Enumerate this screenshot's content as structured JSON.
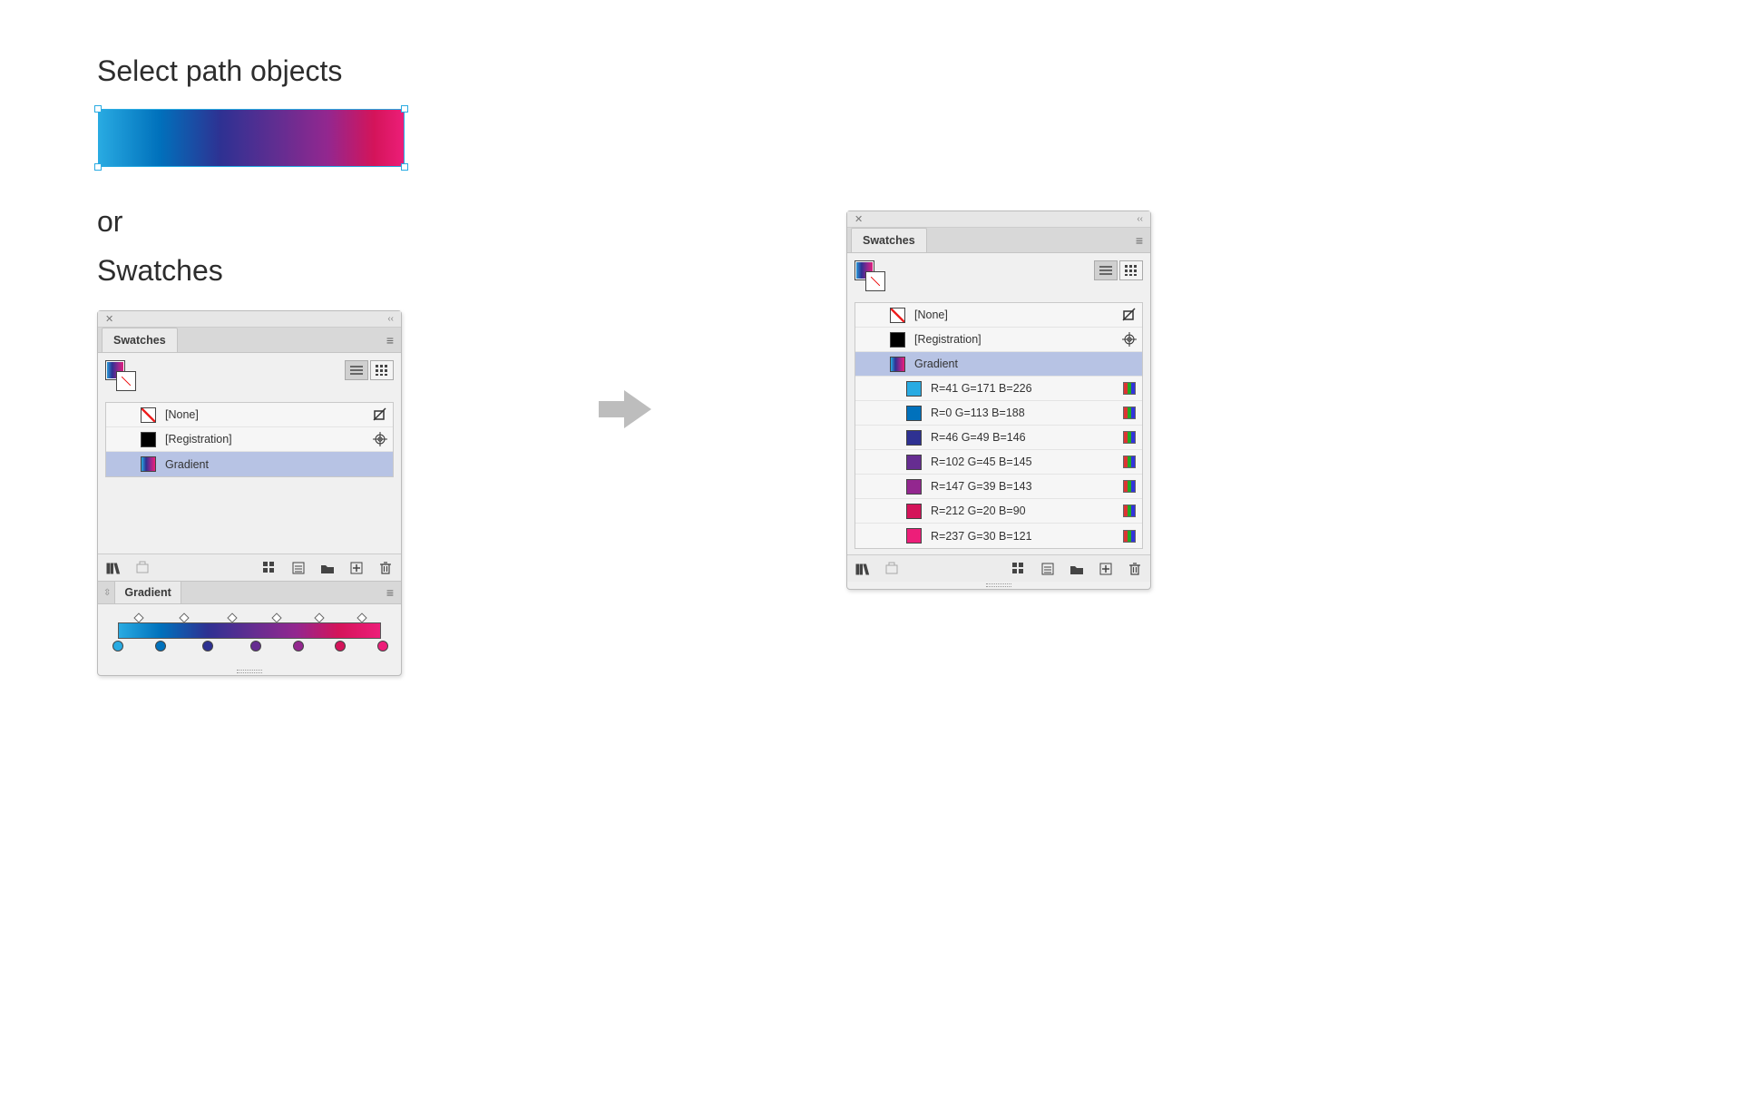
{
  "headings": {
    "select_path": "Select path objects",
    "or": "or",
    "swatches": "Swatches"
  },
  "ui": {
    "swatches_tab": "Swatches",
    "gradient_tab": "Gradient",
    "panel_menu_glyph": "≡",
    "close_glyph": "✕",
    "collapse_glyph": "‹‹",
    "updown_glyph": "⇳"
  },
  "gradient_bar": {
    "stops": [
      {
        "pos": 0,
        "color": "#29abe2"
      },
      {
        "pos": 16,
        "color": "#0071bc"
      },
      {
        "pos": 34,
        "color": "#2e3192"
      },
      {
        "pos": 52,
        "color": "#662d91"
      },
      {
        "pos": 68,
        "color": "#93278f"
      },
      {
        "pos": 84,
        "color": "#d4145a"
      },
      {
        "pos": 100,
        "color": "#ed1e79"
      }
    ],
    "midpoints": [
      8,
      25,
      43,
      60,
      76,
      92
    ]
  },
  "panel_left": {
    "rows": [
      {
        "kind": "none",
        "label": "[None]",
        "selected": false,
        "end_icon": "uneditable"
      },
      {
        "kind": "solid",
        "label": "[Registration]",
        "selected": false,
        "color": "#000000",
        "end_icon": "registration"
      },
      {
        "kind": "grad",
        "label": "Gradient",
        "selected": true
      }
    ]
  },
  "panel_right": {
    "rows": [
      {
        "kind": "none",
        "label": "[None]",
        "selected": false,
        "end_icon": "uneditable"
      },
      {
        "kind": "solid",
        "label": "[Registration]",
        "selected": false,
        "color": "#000000",
        "end_icon": "registration"
      },
      {
        "kind": "grad",
        "label": "Gradient",
        "selected": true
      },
      {
        "kind": "solid",
        "label": "R=41 G=171 B=226",
        "color": "#29abe2",
        "indent": true,
        "end_icon": "rgb"
      },
      {
        "kind": "solid",
        "label": "R=0 G=113 B=188",
        "color": "#0071bc",
        "indent": true,
        "end_icon": "rgb"
      },
      {
        "kind": "solid",
        "label": "R=46 G=49 B=146",
        "color": "#2e3192",
        "indent": true,
        "end_icon": "rgb"
      },
      {
        "kind": "solid",
        "label": "R=102 G=45 B=145",
        "color": "#662d91",
        "indent": true,
        "end_icon": "rgb"
      },
      {
        "kind": "solid",
        "label": "R=147 G=39 B=143",
        "color": "#93278f",
        "indent": true,
        "end_icon": "rgb"
      },
      {
        "kind": "solid",
        "label": "R=212 G=20 B=90",
        "color": "#d4145a",
        "indent": true,
        "end_icon": "rgb"
      },
      {
        "kind": "solid",
        "label": "R=237 G=30 B=121",
        "color": "#ed1e79",
        "indent": true,
        "end_icon": "rgb"
      }
    ]
  },
  "footer_icons": {
    "library": "library-icon",
    "add_group": "swatch-group-icon",
    "show_kind": "swatch-kind-icon",
    "options": "swatch-options-icon",
    "folder": "folder-icon",
    "new": "new-swatch-icon",
    "trash": "trash-icon"
  }
}
